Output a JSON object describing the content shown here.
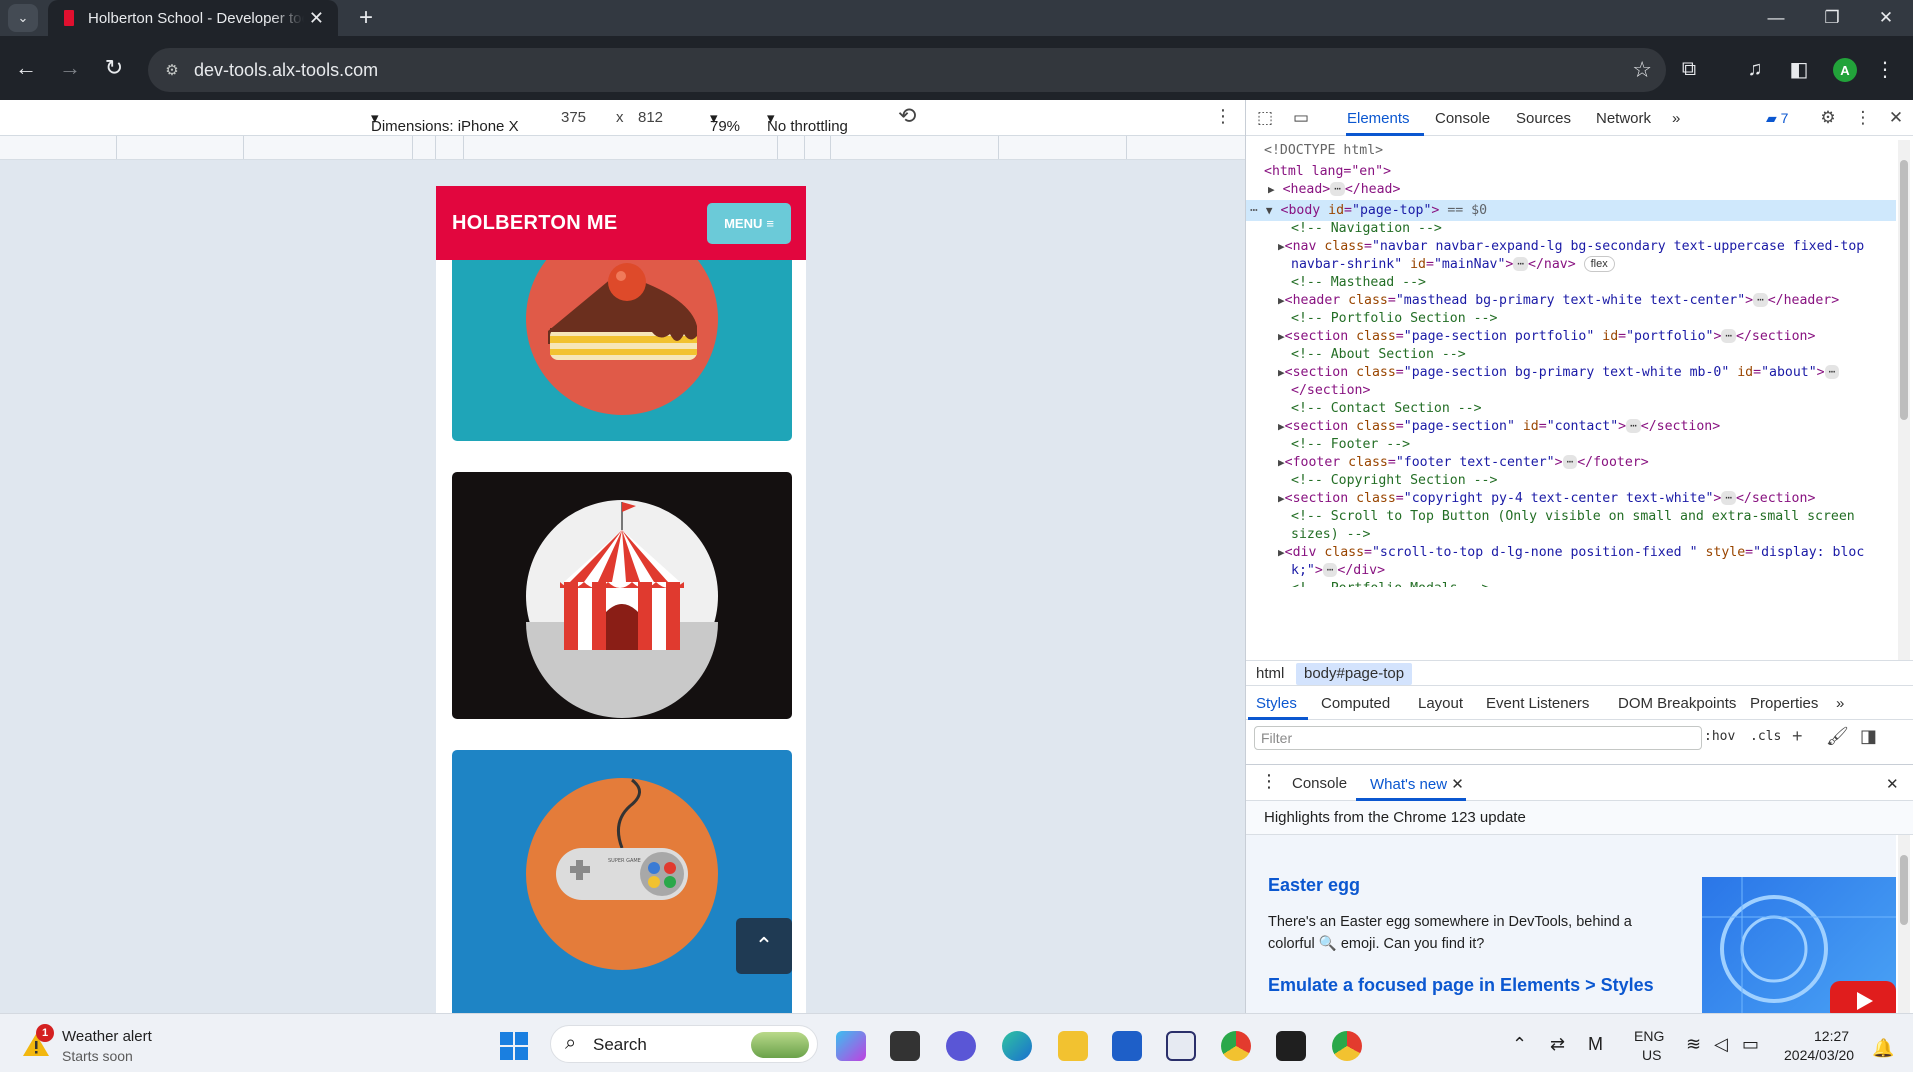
{
  "browser": {
    "tab_title": "Holberton School - Developer tools",
    "url": "dev-tools.alx-tools.com",
    "profile_initial": "A"
  },
  "device_toolbar": {
    "dimensions_label": "Dimensions: iPhone X",
    "width": "375",
    "times": "x",
    "height": "812",
    "zoom": "79%",
    "throttling": "No throttling"
  },
  "site": {
    "brand": "HOLBERTON ME",
    "menu_label": "MENU",
    "accent": "#e2063e",
    "menu_color": "#6bcad8",
    "cards": [
      {
        "icon": "cake-icon",
        "bg": "#1fa5b8"
      },
      {
        "icon": "circus-tent-icon",
        "bg": "#141010"
      },
      {
        "icon": "game-controller-icon",
        "bg": "#1e84c5"
      }
    ],
    "controller_text": "SUPER GAME"
  },
  "devtools": {
    "tabs": [
      "Elements",
      "Console",
      "Sources",
      "Network"
    ],
    "active_tab": "Elements",
    "issues_count": "7",
    "dom": {
      "doctype": "<!DOCTYPE html>",
      "html_open": "<html lang=\"en\">",
      "head": "<head>",
      "head_close": "</head>",
      "body_tag": "body",
      "body_attr": "id",
      "body_val": "\"page-top\"",
      "body_suffix": "== $0",
      "c_navigation": "<!-- Navigation -->",
      "nav_class": "\"navbar navbar-expand-lg bg-secondary text-uppercase fixed-top",
      "nav_class2": "navbar-shrink\"",
      "nav_id": "\"mainNav\"",
      "flex_badge": "flex",
      "c_masthead": "<!-- Masthead -->",
      "header_class": "\"masthead bg-primary text-white text-center\"",
      "c_portfolio": "<!-- Portfolio Section -->",
      "portfolio_class": "\"page-section portfolio\"",
      "portfolio_id": "\"portfolio\"",
      "c_about": "<!-- About Section -->",
      "about_class": "\"page-section bg-primary text-white mb-0\"",
      "about_id": "\"about\"",
      "c_contact": "<!-- Contact Section -->",
      "contact_class": "\"page-section\"",
      "contact_id": "\"contact\"",
      "c_footer": "<!-- Footer -->",
      "footer_class": "\"footer text-center\"",
      "c_copyright": "<!-- Copyright Section -->",
      "copyright_class": "\"copyright py-4 text-center text-white\"",
      "c_scroll1": "<!-- Scroll to Top Button (Only visible on small and extra-small screen",
      "c_scroll2": "sizes) -->",
      "div_class": "\"scroll-to-top d-lg-none position-fixed \"",
      "div_style": "\"display: bloc",
      "div_style2": "k;\"",
      "c_portfolio_modals": "<!-- Portfolio Modals -->"
    },
    "breadcrumbs": [
      "html",
      "body#page-top"
    ],
    "styles_tabs": [
      "Styles",
      "Computed",
      "Layout",
      "Event Listeners",
      "DOM Breakpoints",
      "Properties"
    ],
    "filter_placeholder": "Filter",
    "hov": ":hov",
    "cls": ".cls",
    "drawer_tabs": [
      "Console",
      "What's new"
    ],
    "highlights": "Highlights from the Chrome 123 update",
    "easter_title": "Easter egg",
    "easter_text": "There's an Easter egg somewhere in DevTools, behind a colorful 🔍 emoji. Can you find it?",
    "emulate_title": "Emulate a focused page in Elements > Styles"
  },
  "taskbar": {
    "weather_badge": "1",
    "weather_title": "Weather alert",
    "weather_sub": "Starts soon",
    "search_label": "Search",
    "lang1": "ENG",
    "lang2": "US",
    "time": "12:27",
    "date": "2024/03/20"
  }
}
